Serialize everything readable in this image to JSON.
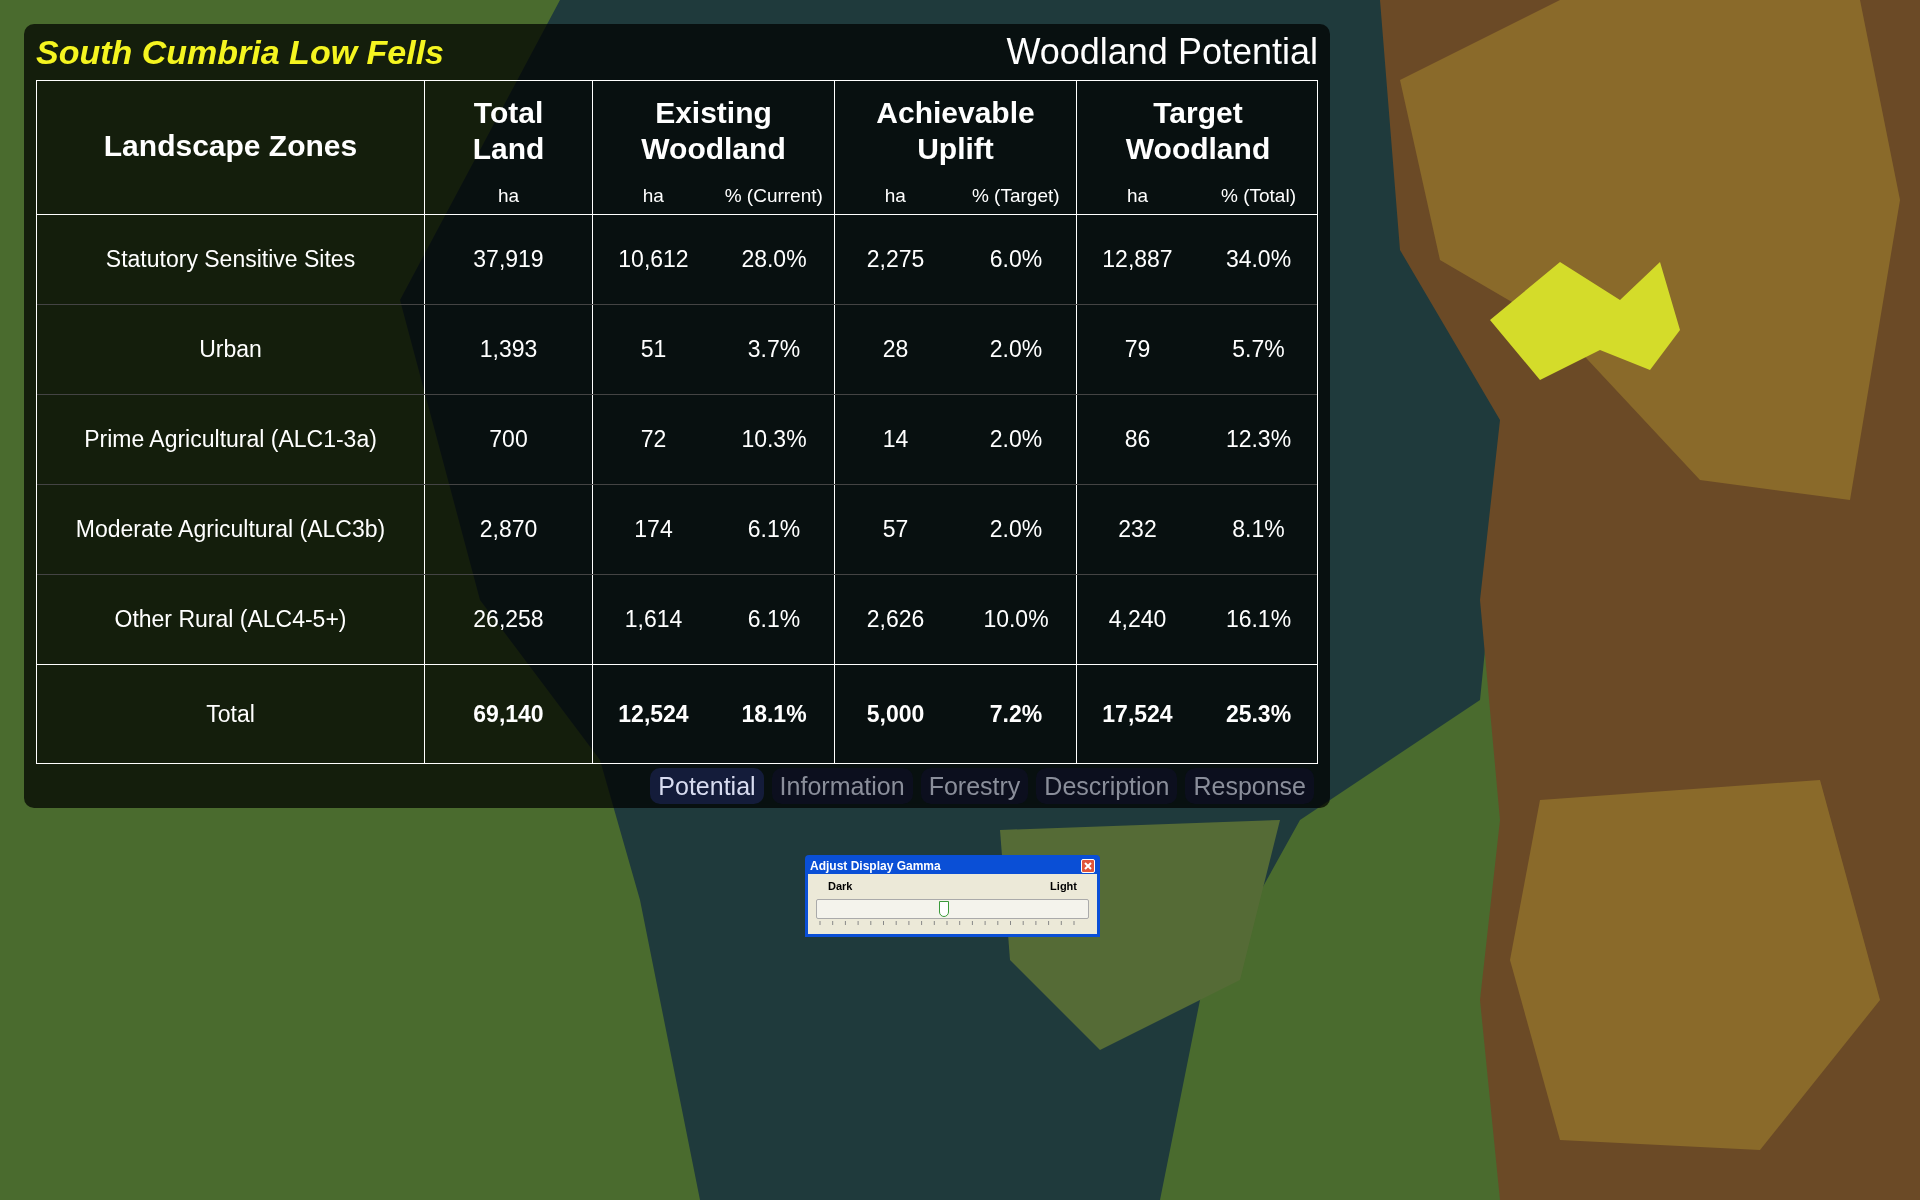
{
  "panel": {
    "title": "South Cumbria Low Fells",
    "subtitle": "Woodland Potential"
  },
  "table": {
    "column_groups": [
      "Existing Woodland",
      "Achievable Uplift",
      "Target Woodland"
    ],
    "columns": [
      {
        "label": "Landscape Zones"
      },
      {
        "label": "Total Land",
        "unit": "ha"
      },
      {
        "unit": "ha"
      },
      {
        "unit": "% (Current)"
      },
      {
        "unit": "ha"
      },
      {
        "unit": "% (Target)"
      },
      {
        "unit": "ha"
      },
      {
        "unit": "% (Total)"
      }
    ],
    "rows": [
      {
        "cells": [
          "Statutory Sensitive Sites",
          "37,919",
          "10,612",
          "28.0%",
          "2,275",
          "6.0%",
          "12,887",
          "34.0%"
        ]
      },
      {
        "cells": [
          "Urban",
          "1,393",
          "51",
          "3.7%",
          "28",
          "2.0%",
          "79",
          "5.7%"
        ]
      },
      {
        "cells": [
          "Prime Agricultural (ALC1-3a)",
          "700",
          "72",
          "10.3%",
          "14",
          "2.0%",
          "86",
          "12.3%"
        ]
      },
      {
        "cells": [
          "Moderate Agricultural (ALC3b)",
          "2,870",
          "174",
          "6.1%",
          "57",
          "2.0%",
          "232",
          "8.1%"
        ]
      },
      {
        "cells": [
          "Other Rural (ALC4-5+)",
          "26,258",
          "1,614",
          "6.1%",
          "2,626",
          "10.0%",
          "4,240",
          "16.1%"
        ]
      }
    ],
    "total": {
      "cells": [
        "Total",
        "69,140",
        "12,524",
        "18.1%",
        "5,000",
        "7.2%",
        "17,524",
        "25.3%"
      ]
    }
  },
  "tabs": [
    {
      "label": "Potential",
      "selected": true
    },
    {
      "label": "Information",
      "selected": false
    },
    {
      "label": "Forestry",
      "selected": false
    },
    {
      "label": "Description",
      "selected": false
    },
    {
      "label": "Response",
      "selected": false
    }
  ],
  "gamma_dialog": {
    "title": "Adjust Display Gamma",
    "min_label": "Dark",
    "max_label": "Light",
    "level": 0.47
  }
}
